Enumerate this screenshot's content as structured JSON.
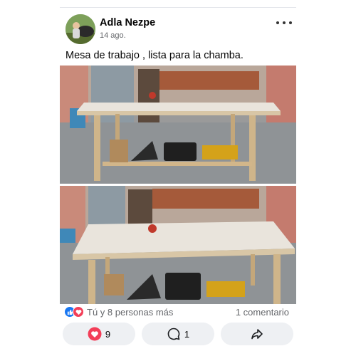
{
  "post": {
    "author": "Adla Nezpe",
    "time": "14 ago.",
    "caption": "Mesa de trabajo , lista para la chamba."
  },
  "reactions": {
    "summary": "Tú y 8 personas más",
    "comments": "1 comentario",
    "icons": [
      "like-icon",
      "love-icon"
    ],
    "like_color": "#1877f2",
    "love_color": "#f33e58"
  },
  "actions": {
    "love_count": "9",
    "comment_count": "1",
    "share_icon": "share-icon"
  }
}
